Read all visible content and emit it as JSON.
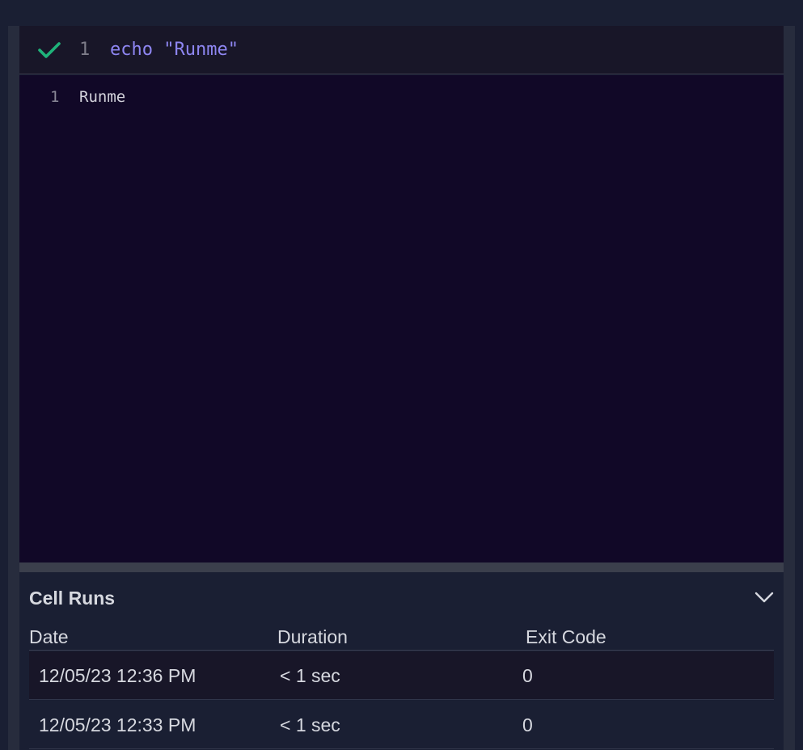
{
  "code_cell": {
    "status": "success",
    "status_icon": "check-icon",
    "line_number": "1",
    "code": "echo \"Runme\""
  },
  "output": {
    "line_number": "1",
    "text": "Runme"
  },
  "cell_runs": {
    "title": "Cell Runs",
    "toggle_icon": "chevron-down-icon",
    "columns": [
      "Date",
      "Duration",
      "Exit Code"
    ],
    "rows": [
      {
        "date": "12/05/23 12:36 PM",
        "duration": "< 1 sec",
        "exit_code": "0"
      },
      {
        "date": "12/05/23 12:33 PM",
        "duration": "< 1 sec",
        "exit_code": "0"
      }
    ]
  },
  "colors": {
    "success": "#1fb37a",
    "code_keyword": "#8e86f2",
    "background": "#1a1f33",
    "output_background": "#110827"
  }
}
